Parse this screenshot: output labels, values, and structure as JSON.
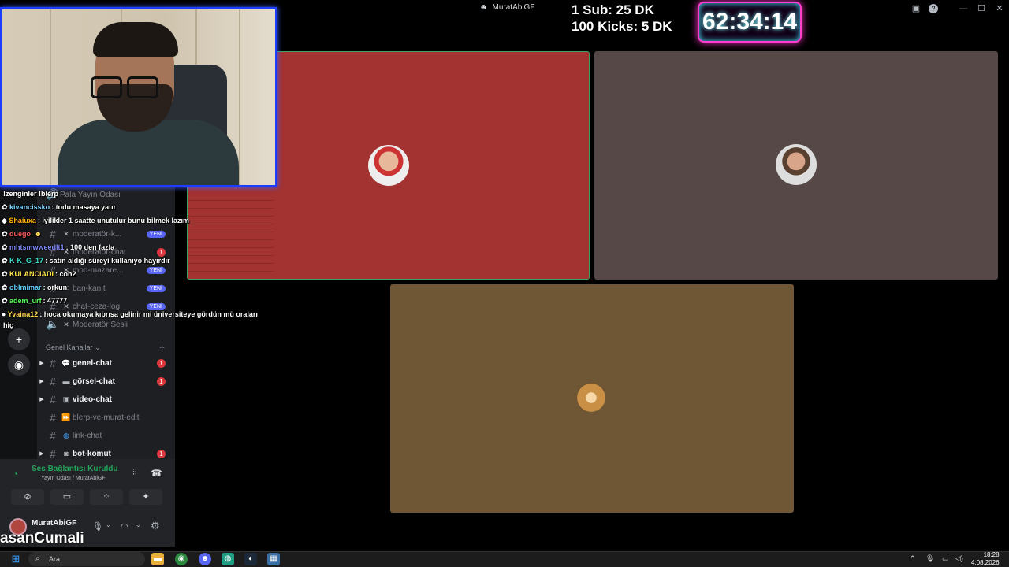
{
  "window": {
    "title": "MuratAbiGF",
    "logo_icon": "discord-icon",
    "controls": [
      "inbox-icon",
      "help-icon",
      "minimize-icon",
      "maximize-icon",
      "close-icon"
    ]
  },
  "overlay": {
    "sub_line": "1 Sub: 25 DK",
    "kick_line": "100 Kicks: 5 DK",
    "timer": "62:34:14",
    "streamer_name": "asanCumali"
  },
  "colors": {
    "tile_red": "#a33331",
    "tile_gray": "#574848",
    "tile_brown": "#6f5634",
    "speaking_border": "#3ba55c",
    "webcam_border": "#1a3dff"
  },
  "server_buttons": [
    "add-server-icon",
    "discover-icon"
  ],
  "channels": {
    "voice_top": {
      "name": "Pala Yayın Odası"
    },
    "staff": [
      {
        "name": "moderatör-k...",
        "badge": "YENİ"
      },
      {
        "name": "moderatör-chat",
        "badge": "1"
      },
      {
        "name": "mod-mazare...",
        "badge": "YENİ"
      },
      {
        "name": "ban-kanıt",
        "badge": "YENİ"
      },
      {
        "name": "chat-ceza-log",
        "badge": "YENİ"
      },
      {
        "name": "Moderatör Sesli",
        "badge": ""
      }
    ],
    "category": "Genel Kanallar",
    "general": [
      {
        "name": "genel-chat",
        "badge": "1",
        "icon": "speech-bubble-icon",
        "bright": true
      },
      {
        "name": "görsel-chat",
        "badge": "1",
        "icon": "image-icon",
        "bright": true
      },
      {
        "name": "video-chat",
        "badge": "",
        "icon": "video-icon",
        "bright": true
      },
      {
        "name": "blerp-ve-murat-edit",
        "badge": "",
        "icon": "fast-forward-icon",
        "bright": false
      },
      {
        "name": "link-chat",
        "badge": "",
        "icon": "globe-icon",
        "bright": false
      },
      {
        "name": "bot-komut",
        "badge": "1",
        "icon": "robot-icon",
        "bright": true
      }
    ]
  },
  "chat": [
    {
      "user": "",
      "text": "!zenginler !blerp",
      "color": "#ffffff"
    },
    {
      "user": "kivancissko",
      "text": ": todu masaya yatır",
      "color": "#7fd6ff"
    },
    {
      "user": "Shaiuxa",
      "text": ": iyilikler 1 saatte unutulur bunu bilmek lazım",
      "color": "#ffb300"
    },
    {
      "user": "duego",
      "text": "",
      "color": "#ff5a5a"
    },
    {
      "user": "mhtsmwweedlt1",
      "text": ": 100 den fazla",
      "color": "#7f8bff"
    },
    {
      "user": "K-K_G_17",
      "text": ": satın aldığı süreyi kullanıyo hayırdır",
      "color": "#3fe3d0"
    },
    {
      "user": "KULANCIADI",
      "text": ": coh2",
      "color": "#ffe94d"
    },
    {
      "user": "oblmimar",
      "text": ": orkun",
      "color": "#5fd0ff"
    },
    {
      "user": "adem_urf",
      "text": ": 47777",
      "color": "#5aff5a"
    },
    {
      "user": "Yvaina12",
      "text": ": hoca okumaya kıbrısa gelinir mi üniversiteye gördün mü oraları",
      "color": "#ffd84d"
    },
    {
      "user": "",
      "text": "hiç",
      "color": "#ffffff"
    }
  ],
  "voice": {
    "status": "Ses Bağlantısı Kuruldu",
    "room": "Yayın Odası",
    "server": "/ MuratAbiGF",
    "actions": [
      "camera-off-icon",
      "screen-share-icon",
      "activities-icon",
      "soundboard-icon"
    ]
  },
  "user": {
    "name": "MuratAbiGF"
  },
  "taskbar": {
    "search_placeholder": "Ara",
    "time": "18:28",
    "date": "4.08.2026",
    "apps": [
      "file-explorer-icon",
      "chrome-icon",
      "discord-app-icon",
      "obs-icon",
      "steam-icon",
      "calculator-icon"
    ]
  }
}
